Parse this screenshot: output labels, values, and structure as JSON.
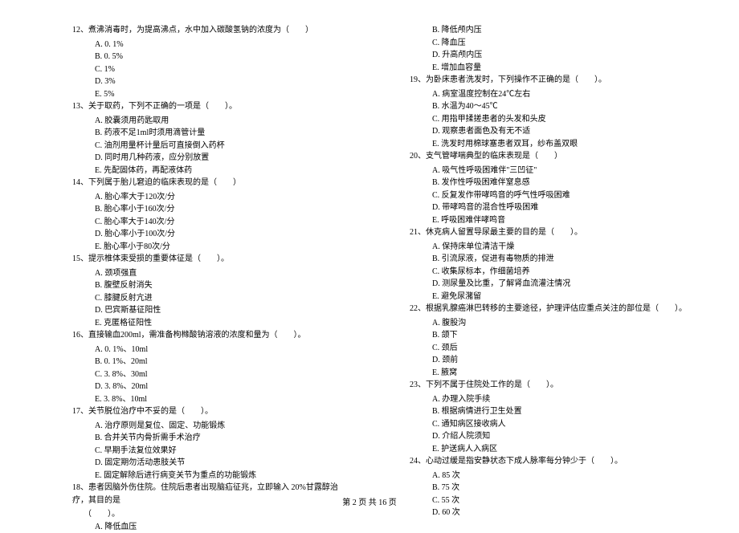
{
  "footer": "第 2 页 共 16 页",
  "left": [
    {
      "type": "q",
      "text": "12、煮沸消毒时，为提高沸点，水中加入碳酸氢钠的浓度为（　　）"
    },
    {
      "type": "o",
      "text": "A. 0. 1%"
    },
    {
      "type": "o",
      "text": "B. 0. 5%"
    },
    {
      "type": "o",
      "text": "C. 1%"
    },
    {
      "type": "o",
      "text": "D. 3%"
    },
    {
      "type": "o",
      "text": "E. 5%"
    },
    {
      "type": "q",
      "text": "13、关于取药，下列不正确的一项是（　　）。"
    },
    {
      "type": "o",
      "text": "A. 胶囊须用药匙取用"
    },
    {
      "type": "o",
      "text": "B. 药液不足1ml时须用滴管计量"
    },
    {
      "type": "o",
      "text": "C. 油剂用量杯计量后可直接倒入药杯"
    },
    {
      "type": "o",
      "text": "D. 同时用几种药液，应分别放置"
    },
    {
      "type": "o",
      "text": "E. 先配固体药，再配液体药"
    },
    {
      "type": "q",
      "text": "14、下列属于胎儿窘迫的临床表现的是（　　）"
    },
    {
      "type": "o",
      "text": "A. 胎心率大于120次/分"
    },
    {
      "type": "o",
      "text": "B. 胎心率小于160次/分"
    },
    {
      "type": "o",
      "text": "C. 胎心率大于140次/分"
    },
    {
      "type": "o",
      "text": "D. 胎心率小于100次/分"
    },
    {
      "type": "o",
      "text": "E. 胎心率小于80次/分"
    },
    {
      "type": "q",
      "text": "15、提示椎体束受损的重要体征是（　　）。"
    },
    {
      "type": "o",
      "text": "A. 颈项强直"
    },
    {
      "type": "o",
      "text": "B. 腹壁反射消失"
    },
    {
      "type": "o",
      "text": "C. 膝腱反射亢进"
    },
    {
      "type": "o",
      "text": "D. 巴宾斯基征阳性"
    },
    {
      "type": "o",
      "text": "E. 克匿格征阳性"
    },
    {
      "type": "q",
      "text": "16、直接输血200ml，需准备枸橼酸钠溶液的浓度和量为（　　）。"
    },
    {
      "type": "o",
      "text": "A. 0. 1%、10ml"
    },
    {
      "type": "o",
      "text": "B. 0. 1%、20ml"
    },
    {
      "type": "o",
      "text": "C. 3. 8%、30ml"
    },
    {
      "type": "o",
      "text": "D. 3. 8%、20ml"
    },
    {
      "type": "o",
      "text": "E. 3. 8%、10ml"
    },
    {
      "type": "q",
      "text": "17、关节脱位治疗中不妥的是（　　）。"
    },
    {
      "type": "o",
      "text": "A. 治疗原则是复位、固定、功能锻炼"
    },
    {
      "type": "o",
      "text": "B. 合并关节内骨折需手术治疗"
    },
    {
      "type": "o",
      "text": "C. 早期手法复位效果好"
    },
    {
      "type": "o",
      "text": "D. 固定期勿活动患肢关节"
    },
    {
      "type": "o",
      "text": "E. 固定解除后进行病变关节为重点的功能锻炼"
    },
    {
      "type": "q",
      "text": "18、患者因脑外伤住院。住院后患者出现脑疝征兆，立即输入 20%甘露醇治疗，其目的是"
    },
    {
      "type": "i",
      "text": "（　　）。"
    },
    {
      "type": "o",
      "text": "A. 降低血压"
    }
  ],
  "right": [
    {
      "type": "o",
      "text": "B. 降低颅内压"
    },
    {
      "type": "o",
      "text": "C. 降血压"
    },
    {
      "type": "o",
      "text": "D. 升高颅内压"
    },
    {
      "type": "o",
      "text": "E. 增加血容量"
    },
    {
      "type": "q",
      "text": "19、为卧床患者洗发时，下列操作不正确的是（　　）。"
    },
    {
      "type": "o",
      "text": "A. 病室温度控制在24℃左右"
    },
    {
      "type": "o",
      "text": "B. 水温为40～45℃"
    },
    {
      "type": "o",
      "text": "C. 用指甲揉搓患者的头发和头皮"
    },
    {
      "type": "o",
      "text": "D. 观察患者面色及有无不适"
    },
    {
      "type": "o",
      "text": "E. 洗发时用棉球塞患者双耳，纱布盖双眼"
    },
    {
      "type": "q",
      "text": "20、支气管哮喘典型的临床表现是（　　）"
    },
    {
      "type": "o",
      "text": "A. 吸气性呼吸困难伴\"三凹征\""
    },
    {
      "type": "o",
      "text": "B. 发作性呼吸困难伴窒息感"
    },
    {
      "type": "o",
      "text": "C. 反复发作带哮鸣音的呼气性呼吸困难"
    },
    {
      "type": "o",
      "text": "D. 带哮鸣音的混合性呼吸困难"
    },
    {
      "type": "o",
      "text": "E. 呼吸困难伴哮鸣音"
    },
    {
      "type": "q",
      "text": "21、休克病人留置导尿最主要的目的是（　　）。"
    },
    {
      "type": "o",
      "text": "A. 保持床单位清洁干燥"
    },
    {
      "type": "o",
      "text": "B. 引流尿液，促进有毒物质的排泄"
    },
    {
      "type": "o",
      "text": "C. 收集尿标本，作细菌培养"
    },
    {
      "type": "o",
      "text": "D. 测尿量及比重，了解肾血流灌注情况"
    },
    {
      "type": "o",
      "text": "E. 避免尿潴留"
    },
    {
      "type": "q",
      "text": "22、根据乳腺癌淋巴转移的主要途径，护理评估应重点关注的部位是（　　）。"
    },
    {
      "type": "o",
      "text": "A. 腹股沟"
    },
    {
      "type": "o",
      "text": "B. 颌下"
    },
    {
      "type": "o",
      "text": "C. 颈后"
    },
    {
      "type": "o",
      "text": "D. 颈前"
    },
    {
      "type": "o",
      "text": "E. 腋窝"
    },
    {
      "type": "q",
      "text": "23、下列不属于住院处工作的是（　　）。"
    },
    {
      "type": "o",
      "text": "A. 办理入院手续"
    },
    {
      "type": "o",
      "text": "B. 根据病情进行卫生处置"
    },
    {
      "type": "o",
      "text": "C. 通知病区接收病人"
    },
    {
      "type": "o",
      "text": "D. 介绍人院须知"
    },
    {
      "type": "o",
      "text": "E. 护送病人入病区"
    },
    {
      "type": "q",
      "text": "24、心动过缓是指安静状态下成人脉率每分钟少于（　　）。"
    },
    {
      "type": "o",
      "text": "A. 85 次"
    },
    {
      "type": "o",
      "text": "B. 75 次"
    },
    {
      "type": "o",
      "text": "C. 55 次"
    },
    {
      "type": "o",
      "text": "D. 60 次"
    }
  ]
}
